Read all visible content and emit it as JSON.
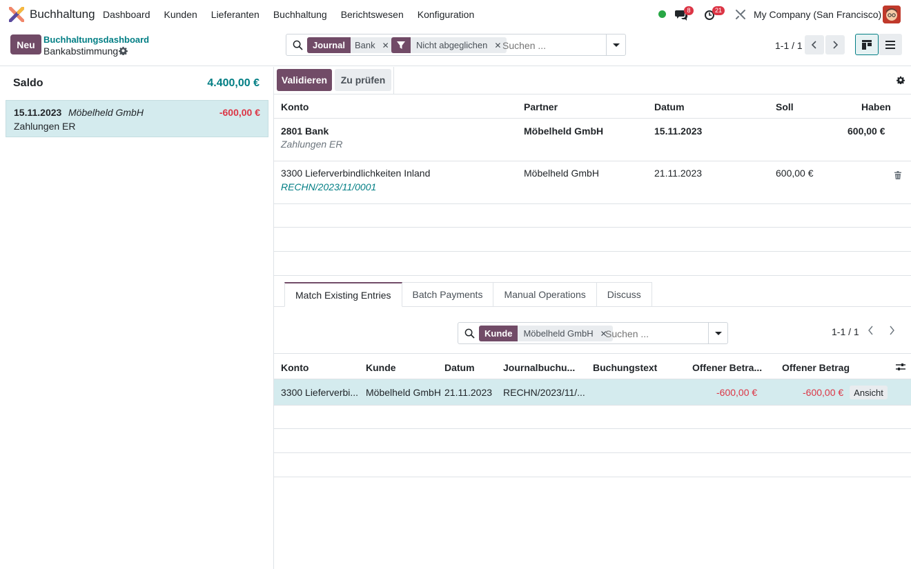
{
  "app": {
    "name": "Buchhaltung",
    "menu": [
      "Dashboard",
      "Kunden",
      "Lieferanten",
      "Buchhaltung",
      "Berichtswesen",
      "Konfiguration"
    ],
    "messages_count": "8",
    "activities_count": "21",
    "company": "My Company (San Francisco)"
  },
  "control": {
    "new_label": "Neu",
    "breadcrumb_parent": "Buchhaltungsdashboard",
    "breadcrumb_current": "Bankabstimmung",
    "search": {
      "facet1_type": "Journal",
      "facet1_value": "Bank",
      "facet2_value": "Nicht abgeglichen",
      "placeholder": "Suchen ..."
    },
    "pager": "1-1 / 1"
  },
  "left": {
    "saldo_label": "Saldo",
    "saldo_value": "4.400,00 €",
    "statement": {
      "date": "15.11.2023",
      "partner": "Möbelheld GmbH",
      "amount": "-600,00 €",
      "label": "Zahlungen ER"
    }
  },
  "right": {
    "validate_label": "Validieren",
    "review_label": "Zu prüfen",
    "lines_header": {
      "konto": "Konto",
      "partner": "Partner",
      "datum": "Datum",
      "soll": "Soll",
      "haben": "Haben"
    },
    "lines": [
      {
        "konto": "2801 Bank",
        "sub": "Zahlungen ER",
        "partner": "Möbelheld GmbH",
        "datum": "15.11.2023",
        "soll": "",
        "haben": "600,00 €"
      },
      {
        "konto": "3300 Lieferverbindlichkeiten Inland",
        "sub": "RECHN/2023/11/0001",
        "partner": "Möbelheld GmbH",
        "datum": "21.11.2023",
        "soll": "600,00 €",
        "haben": ""
      }
    ],
    "tabs": [
      "Match Existing Entries",
      "Batch Payments",
      "Manual Operations",
      "Discuss"
    ],
    "match": {
      "facet_type": "Kunde",
      "facet_value": "Möbelheld GmbH",
      "placeholder": "Suchen ...",
      "pager": "1-1 / 1",
      "header": {
        "konto": "Konto",
        "kunde": "Kunde",
        "datum": "Datum",
        "journal": "Journalbuchu...",
        "text": "Buchungstext",
        "offen1": "Offener Betra...",
        "offen2": "Offener Betrag"
      },
      "row": {
        "konto": "3300 Lieferverbi...",
        "kunde": "Möbelheld GmbH",
        "datum": "21.11.2023",
        "journal": "RECHN/2023/11/...",
        "text": "",
        "offen1": "-600,00 €",
        "offen2": "-600,00 €",
        "action": "Ansicht"
      }
    }
  },
  "colors": {
    "brand": "#714b67",
    "accent": "#017e84",
    "negative": "#dc3545",
    "selected": "#d4ebee"
  }
}
